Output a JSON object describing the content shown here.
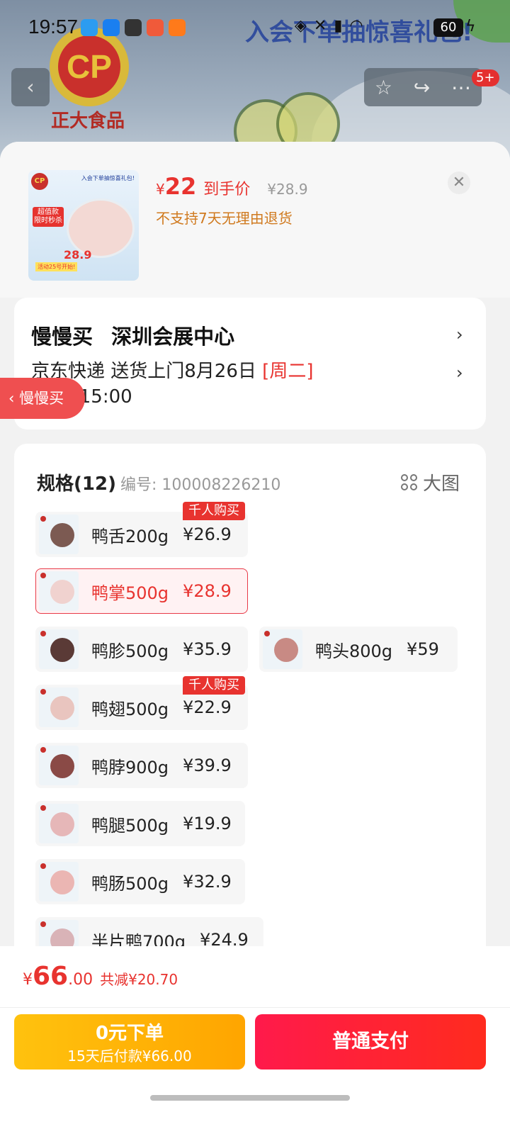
{
  "status_bar": {
    "time": "19:57",
    "battery": "60"
  },
  "background": {
    "brand_logo": "CP",
    "brand_name": "正大食品",
    "banner": "入会下单抽惊喜礼包!"
  },
  "nav": {
    "back_icon": "chevron-left-icon",
    "badge": "5+"
  },
  "product": {
    "currency": "¥",
    "deal_price": "22",
    "deal_label": "到手价",
    "original_price": "¥28.9",
    "return_notice": "不支持7天无理由退货",
    "thumb": {
      "logo": "CP",
      "banner": "入会下单抽惊喜礼包!",
      "tag": "超值款 限时秒杀",
      "price": "28.9",
      "foot": "活动25号开始!"
    }
  },
  "delivery": {
    "pickup_method": "慢慢买",
    "address": "深圳会展中心",
    "shipping": "京东快递 送货上门8月26日",
    "weekday": "[周二]",
    "time_window": "9:00-15:00",
    "floating_tab": "慢慢买"
  },
  "spec": {
    "title": "规格(12)",
    "code": "编号: 100008226210",
    "view_toggle": "大图",
    "options": [
      {
        "name": "鸭舌200g",
        "price": "¥26.9",
        "hot": "千人购买",
        "color": "#7c5a52"
      },
      {
        "name": "鸭掌500g",
        "price": "¥28.9",
        "selected": true,
        "color": "#f0d2cf"
      },
      {
        "name": "鸭胗500g",
        "price": "¥35.9",
        "color": "#5a3a36"
      },
      {
        "name": "鸭头800g",
        "price": "¥59",
        "color": "#c88a84"
      },
      {
        "name": "鸭翅500g",
        "price": "¥22.9",
        "hot": "千人购买",
        "color": "#e9c5bf"
      },
      {
        "name": "鸭脖900g",
        "price": "¥39.9",
        "color": "#8a4a46"
      },
      {
        "name": "鸭腿500g",
        "price": "¥19.9",
        "color": "#e6b7b8"
      },
      {
        "name": "鸭肠500g",
        "price": "¥32.9",
        "color": "#ebb6b3"
      },
      {
        "name": "半片鸭700g",
        "price": "¥24.9",
        "color": "#d9b3b7"
      }
    ]
  },
  "footer": {
    "total_symbol": "¥",
    "total_int": "66",
    "total_dec": ".00",
    "savings": "共减¥20.70",
    "later_title": "0元下单",
    "later_sub": "15天后付款¥66.00",
    "pay_label": "普通支付"
  }
}
